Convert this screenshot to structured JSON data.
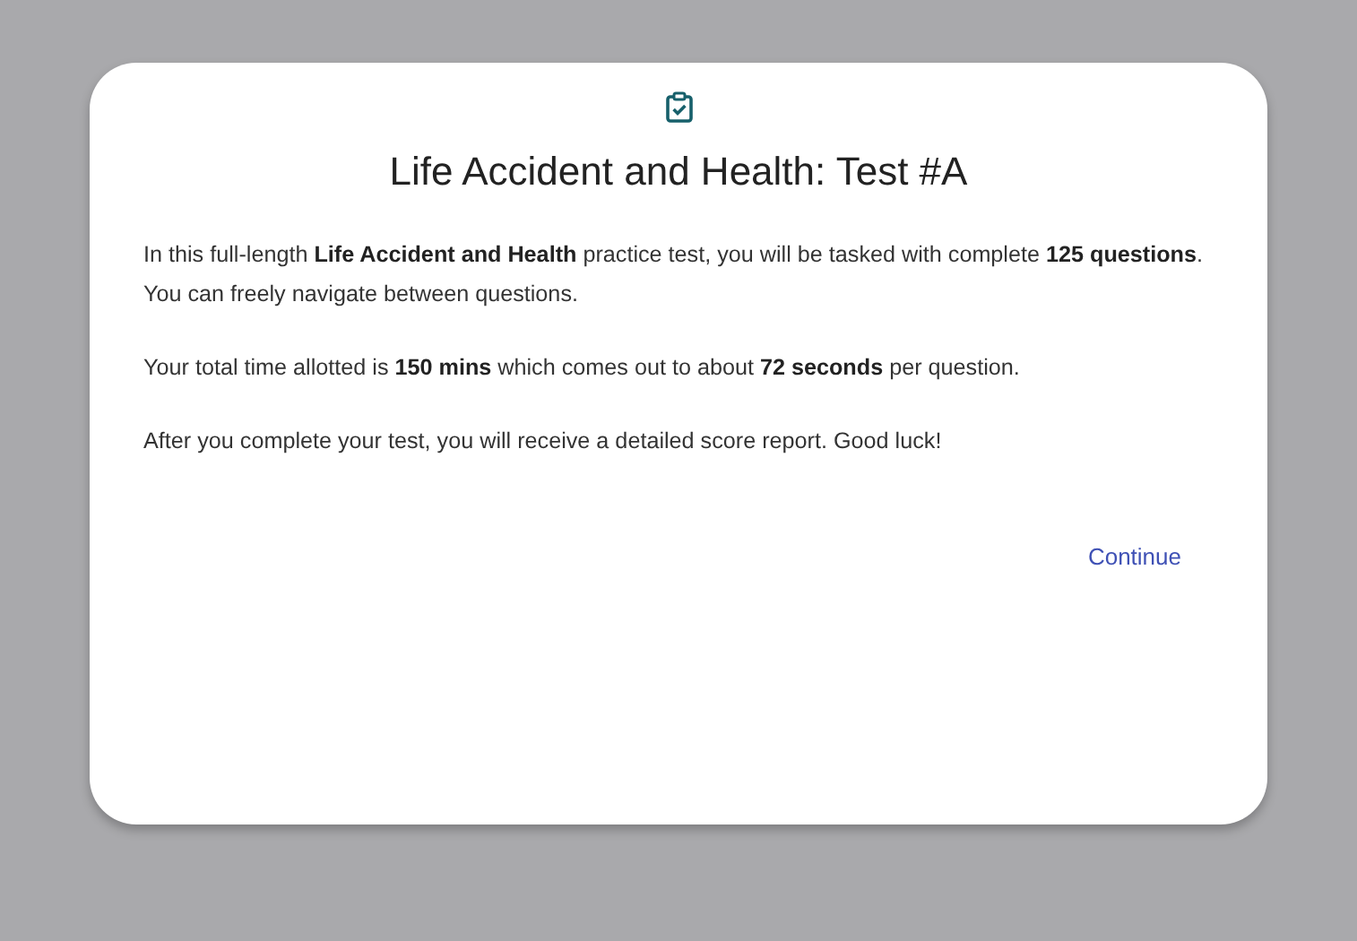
{
  "dialog": {
    "title": "Life Accident and Health: Test #A",
    "paragraphs": [
      "In this full-length **Life Accident and Health** practice test, you will be tasked with complete **125 questions**. You can freely navigate between questions.",
      "Your total time allotted is **150 mins** which comes out to about **72 seconds** per question.",
      "After you complete your test, you will receive a detailed score report. Good luck!"
    ],
    "continue_button": "Continue"
  }
}
